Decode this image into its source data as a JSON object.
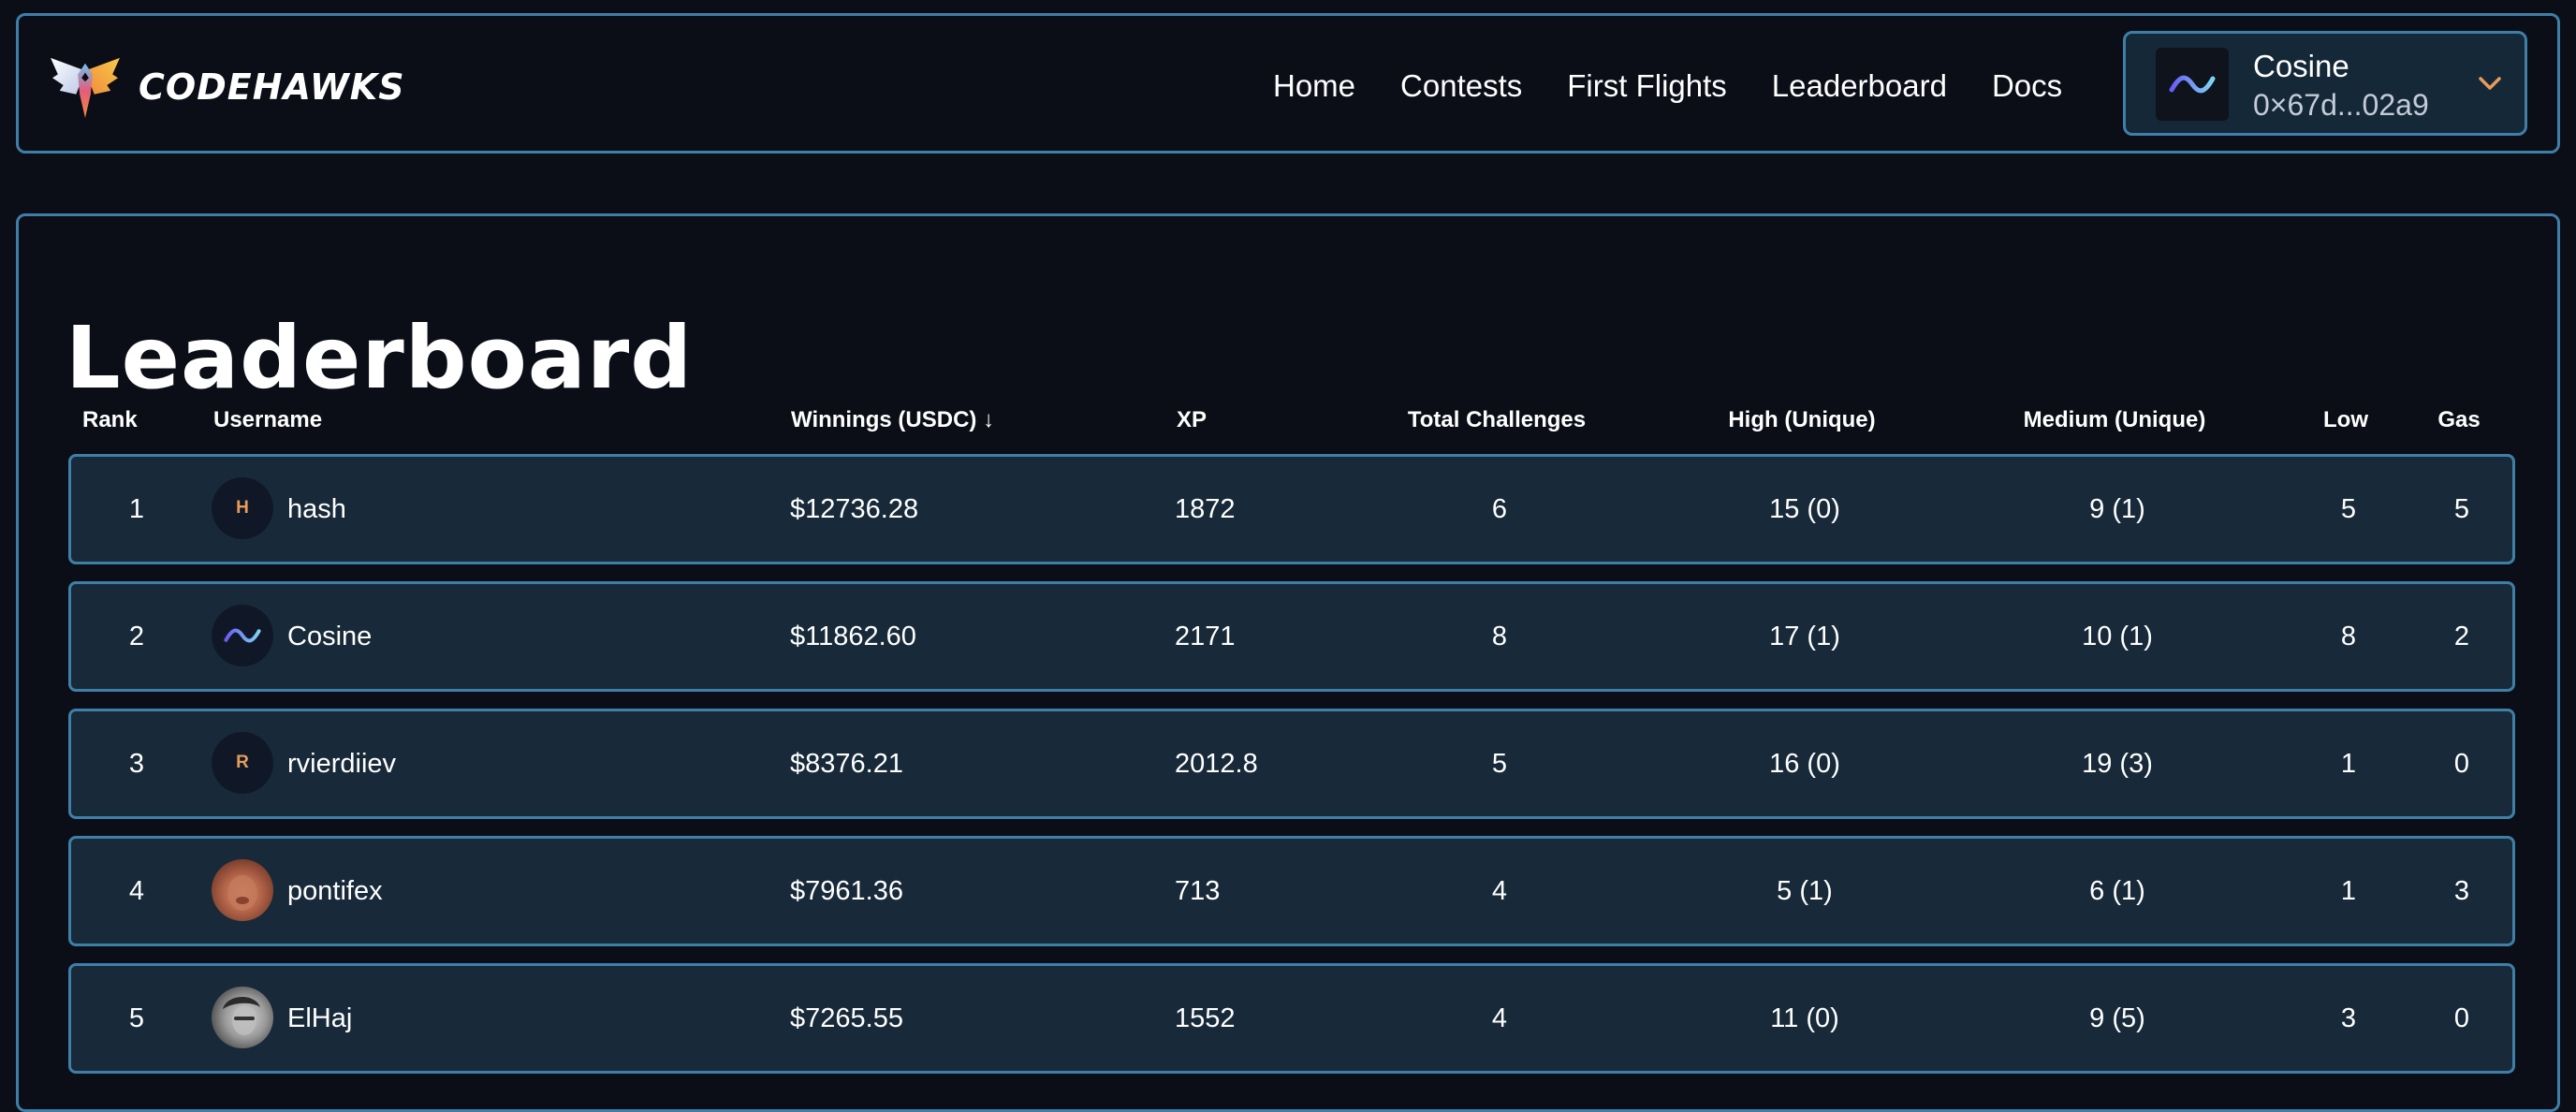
{
  "brand": {
    "name": "CODEHAWKS"
  },
  "nav": {
    "items": [
      "Home",
      "Contests",
      "First Flights",
      "Leaderboard",
      "Docs"
    ]
  },
  "account": {
    "name": "Cosine",
    "address": "0×67d...02a9"
  },
  "page": {
    "title": "Leaderboard"
  },
  "table": {
    "headers": {
      "rank": "Rank",
      "username": "Username",
      "winnings": "Winnings (USDC) ↓",
      "xp": "XP",
      "total": "Total Challenges",
      "high": "High (Unique)",
      "medium": "Medium (Unique)",
      "low": "Low",
      "gas": "Gas"
    },
    "rows": [
      {
        "rank": "1",
        "initial": "H",
        "username": "hash",
        "winnings": "$12736.28",
        "xp": "1872",
        "total": "6",
        "high": "15 (0)",
        "medium": "9 (1)",
        "low": "5",
        "gas": "5"
      },
      {
        "rank": "2",
        "initial": "",
        "username": "Cosine",
        "winnings": "$11862.60",
        "xp": "2171",
        "total": "8",
        "high": "17 (1)",
        "medium": "10 (1)",
        "low": "8",
        "gas": "2"
      },
      {
        "rank": "3",
        "initial": "R",
        "username": "rvierdiiev",
        "winnings": "$8376.21",
        "xp": "2012.8",
        "total": "5",
        "high": "16 (0)",
        "medium": "19 (3)",
        "low": "1",
        "gas": "0"
      },
      {
        "rank": "4",
        "initial": "",
        "username": "pontifex",
        "winnings": "$7961.36",
        "xp": "713",
        "total": "4",
        "high": "5 (1)",
        "medium": "6 (1)",
        "low": "1",
        "gas": "3"
      },
      {
        "rank": "5",
        "initial": "",
        "username": "ElHaj",
        "winnings": "$7265.55",
        "xp": "1552",
        "total": "4",
        "high": "11 (0)",
        "medium": "9 (5)",
        "low": "3",
        "gas": "0"
      }
    ]
  },
  "colors": {
    "background": "#0b0e17",
    "border": "#3e7fa8",
    "row_bg": "#182a39",
    "accent_orange": "#e69c5b"
  }
}
